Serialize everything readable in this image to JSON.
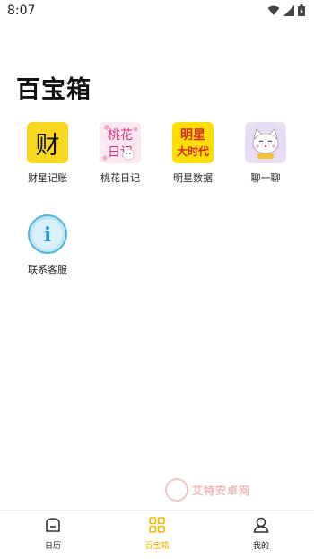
{
  "status": {
    "time": "8:07"
  },
  "page": {
    "title": "百宝箱"
  },
  "tools": [
    {
      "label": "财星记账",
      "icon": "finance-icon",
      "glyph": "财"
    },
    {
      "label": "桃花日记",
      "icon": "peach-diary-icon",
      "line1": "桃花",
      "line2": "日记"
    },
    {
      "label": "明星数据",
      "icon": "star-data-icon",
      "line1": "明星",
      "line2": "大时代"
    },
    {
      "label": "聊一聊",
      "icon": "chat-cat-icon"
    },
    {
      "label": "联系客服",
      "icon": "info-icon",
      "glyph": "i"
    }
  ],
  "watermark": {
    "text": "艾特安卓网"
  },
  "tabbar": {
    "items": [
      {
        "label": "日历",
        "icon": "calendar-icon"
      },
      {
        "label": "百宝箱",
        "icon": "grid-icon",
        "active": true
      },
      {
        "label": "我的",
        "icon": "user-icon"
      }
    ]
  },
  "colors": {
    "accent": "#f3b400",
    "finance_bg": "#f7d81f",
    "star_bg": "#ffdf00"
  }
}
